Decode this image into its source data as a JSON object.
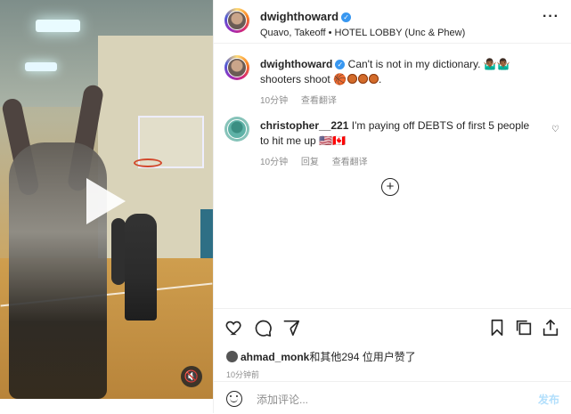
{
  "post_header": {
    "username": "dwighthoward",
    "subtitle": "Quavo, Takeoff • HOTEL LOBBY (Unc & Phew)"
  },
  "caption": {
    "username": "dwighthoward",
    "text": "Can't is not in my dictionary. 🤷🏾‍♂️🤷🏾‍♂️ shooters shoot 🏀",
    "time": "10分钟",
    "see_translation": "查看翻译"
  },
  "comment": {
    "username": "christopher__221",
    "text": "I'm paying off DEBTS of first 5 people to hit me up 🇺🇸🇨🇦",
    "time": "10分钟",
    "reply": "回复",
    "see_translation": "查看翻译"
  },
  "likes": {
    "user": "ahmad_monk",
    "rest": "和其他294 位用户赞了"
  },
  "post_time": "10分钟前",
  "composer": {
    "placeholder": "添加评论...",
    "post_label": "发布"
  },
  "icons": [
    "play-icon",
    "mute-icon",
    "verified-icon",
    "more-icon",
    "heart-icon",
    "comment-icon",
    "share-icon",
    "save-icon",
    "emoji-icon",
    "add-circle-icon"
  ],
  "colors": {
    "accent": "#3897f0",
    "post_disabled": "#b2dffc",
    "meta": "#8e8e8e"
  }
}
